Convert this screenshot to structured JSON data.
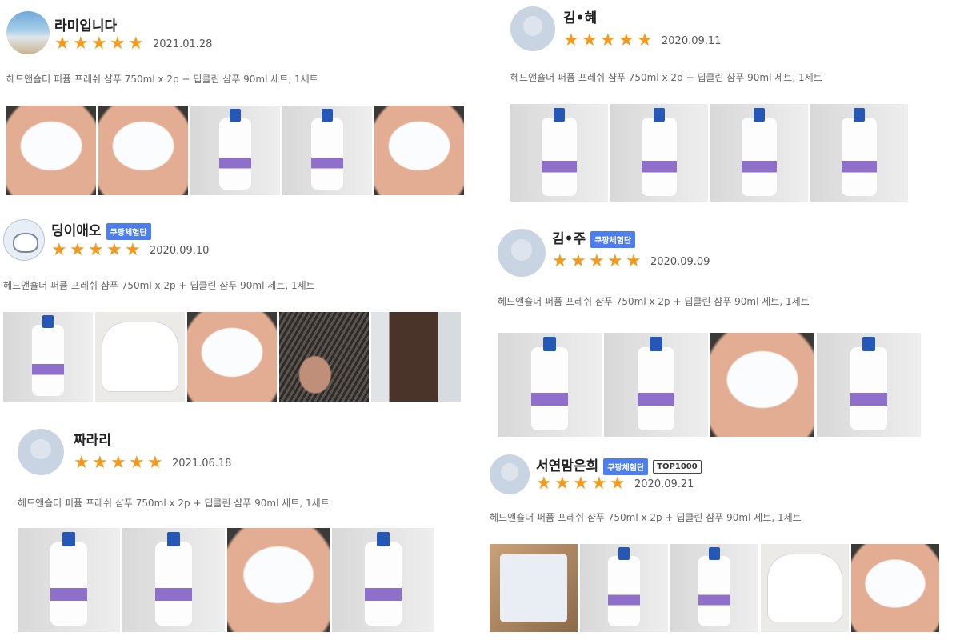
{
  "product": "헤드앤숄더 퍼퓸 프레쉬 샴푸 750ml x 2p + 딥클린 샴푸 90ml 세트, 1세트",
  "star_char": "★",
  "colors": {
    "star": "#f39a1e",
    "badge": "#4d7ef0"
  },
  "reviews": [
    {
      "name": "라미입니다",
      "avatar": "photo",
      "rating": 5,
      "date": "2021.01.28",
      "badges": [],
      "photos": [
        "hand",
        "hand",
        "bottle",
        "bottle",
        "hand"
      ]
    },
    {
      "name": "딩이애오",
      "avatar": "character",
      "rating": 5,
      "date": "2020.09.10",
      "badges": [
        "쿠팡체험단"
      ],
      "photos": [
        "bottle",
        "cap",
        "hand",
        "hair",
        "long"
      ]
    },
    {
      "name": "짜라리",
      "avatar": "default",
      "rating": 5,
      "date": "2021.06.18",
      "badges": [],
      "photos": [
        "bottle",
        "bottle",
        "hand",
        "bottle"
      ]
    },
    {
      "name": "김•혜",
      "avatar": "default",
      "rating": 5,
      "date": "2020.09.11",
      "badges": [],
      "photos": [
        "bottle",
        "bottle",
        "bottle",
        "bottle"
      ]
    },
    {
      "name": "김•주",
      "avatar": "default",
      "rating": 5,
      "date": "2020.09.09",
      "badges": [
        "쿠팡체험단"
      ],
      "photos": [
        "bottle",
        "bottle",
        "hand",
        "bottle"
      ]
    },
    {
      "name": "서연맘은희",
      "avatar": "default",
      "rating": 5,
      "date": "2020.09.21",
      "badges": [
        "쿠팡체험단",
        "TOP1000"
      ],
      "photos": [
        "box",
        "bottle",
        "bottle",
        "cap",
        "hand"
      ]
    }
  ]
}
